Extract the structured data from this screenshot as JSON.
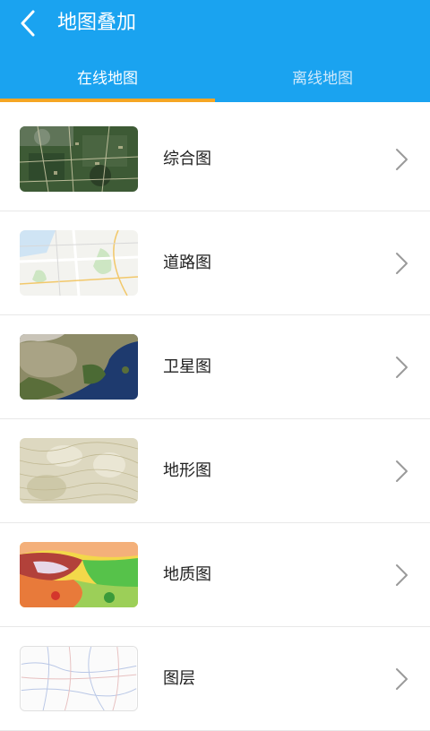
{
  "header": {
    "title": "地图叠加",
    "back_icon": "chevron-left-icon"
  },
  "tabs": [
    {
      "label": "在线地图",
      "active": true
    },
    {
      "label": "离线地图",
      "active": false
    }
  ],
  "colors": {
    "header_bg": "#1aa3f0",
    "tab_indicator": "#f5a623"
  },
  "layers": [
    {
      "label": "综合图",
      "thumbnail": "satellite-with-roads"
    },
    {
      "label": "道路图",
      "thumbnail": "road-map"
    },
    {
      "label": "卫星图",
      "thumbnail": "satellite-imagery"
    },
    {
      "label": "地形图",
      "thumbnail": "terrain-contours"
    },
    {
      "label": "地质图",
      "thumbnail": "geology-map"
    },
    {
      "label": "图层",
      "thumbnail": "boundary-lines"
    }
  ]
}
